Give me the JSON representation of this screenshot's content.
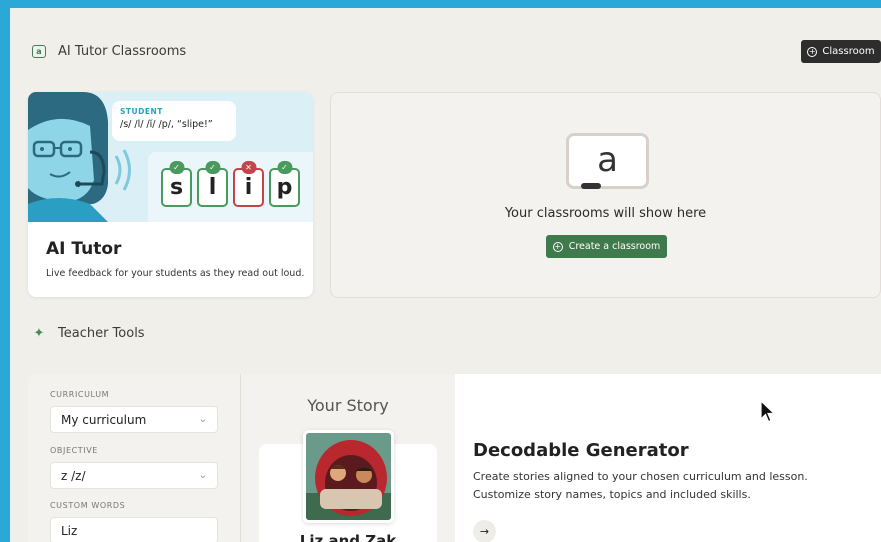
{
  "classrooms": {
    "section_title": "AI Tutor Classrooms",
    "header_button": "Classroom",
    "empty_text": "Your classrooms will show here",
    "create_button": "Create a classroom",
    "icon_letter": "a"
  },
  "tutor_card": {
    "speaker_label": "STUDENT",
    "phonemes": "/s/ /l/ /ĭ/ /p/, “slipe!”",
    "tiles": [
      {
        "letter": "s",
        "status": "correct"
      },
      {
        "letter": "l",
        "status": "correct"
      },
      {
        "letter": "i",
        "status": "incorrect"
      },
      {
        "letter": "p",
        "status": "correct"
      }
    ],
    "title": "AI Tutor",
    "description": "Live feedback for your students as they read out loud."
  },
  "teacher_tools": {
    "section_title": "Teacher Tools",
    "form": {
      "curriculum_label": "CURRICULUM",
      "curriculum_value": "My curriculum",
      "objective_label": "OBJECTIVE",
      "objective_value": "z /z/",
      "custom_words_label": "CUSTOM WORDS",
      "custom_words_value": "Liz"
    },
    "story": {
      "heading": "Your Story",
      "book_title": "Liz and Zak"
    },
    "generator": {
      "title": "Decodable Generator",
      "description": "Create stories aligned to your chosen curriculum and lesson. Customize story names, topics and included skills."
    }
  },
  "colors": {
    "accent_green": "#3f7a4d",
    "dark_button": "#2d2d2d",
    "error_red": "#c4444a",
    "background": "#f1efea"
  }
}
